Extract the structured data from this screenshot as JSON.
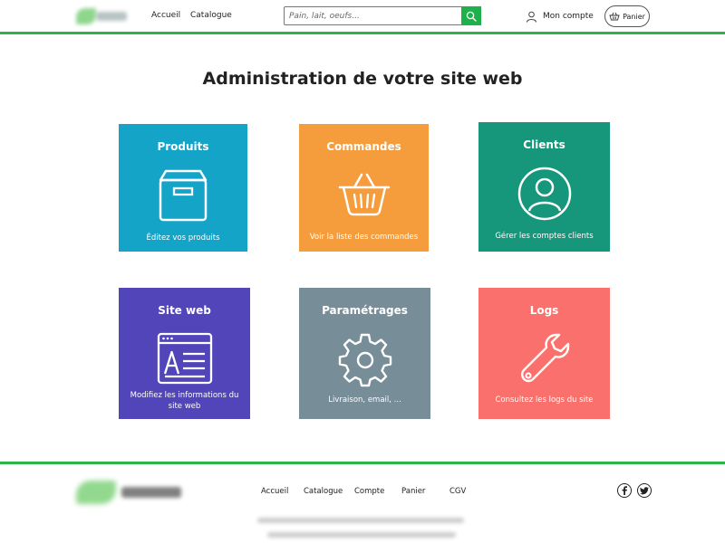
{
  "header": {
    "nav": [
      "Accueil",
      "Catalogue"
    ],
    "search_placeholder": "Pain, lait, oeufs...",
    "account_label": "Mon compte",
    "cart_label": "Panier"
  },
  "page_title": "Administration de votre site web",
  "tiles": [
    {
      "title": "Produits",
      "desc": "Éditez vos produits",
      "color": "#13a4c8",
      "icon": "box-icon"
    },
    {
      "title": "Commandes",
      "desc": "Voir la liste des commandes",
      "color": "#f59c3d",
      "icon": "basket-icon"
    },
    {
      "title": "Clients",
      "desc": "Gérer les comptes clients",
      "color": "#16967a",
      "icon": "user-icon"
    },
    {
      "title": "Site web",
      "desc": "Modifiez les informations  du site web",
      "color": "#5244b9",
      "icon": "webpage-icon"
    },
    {
      "title": "Paramétrages",
      "desc": "Livraison, email, ...",
      "color": "#778d97",
      "icon": "gear-icon"
    },
    {
      "title": "Logs",
      "desc": "Consultez les logs du site",
      "color": "#fa706c",
      "icon": "wrench-icon"
    }
  ],
  "footer": {
    "links": [
      "Accueil",
      "Catalogue",
      "Compte",
      "Panier",
      "CGV"
    ],
    "social": [
      "facebook-icon",
      "twitter-icon"
    ]
  }
}
